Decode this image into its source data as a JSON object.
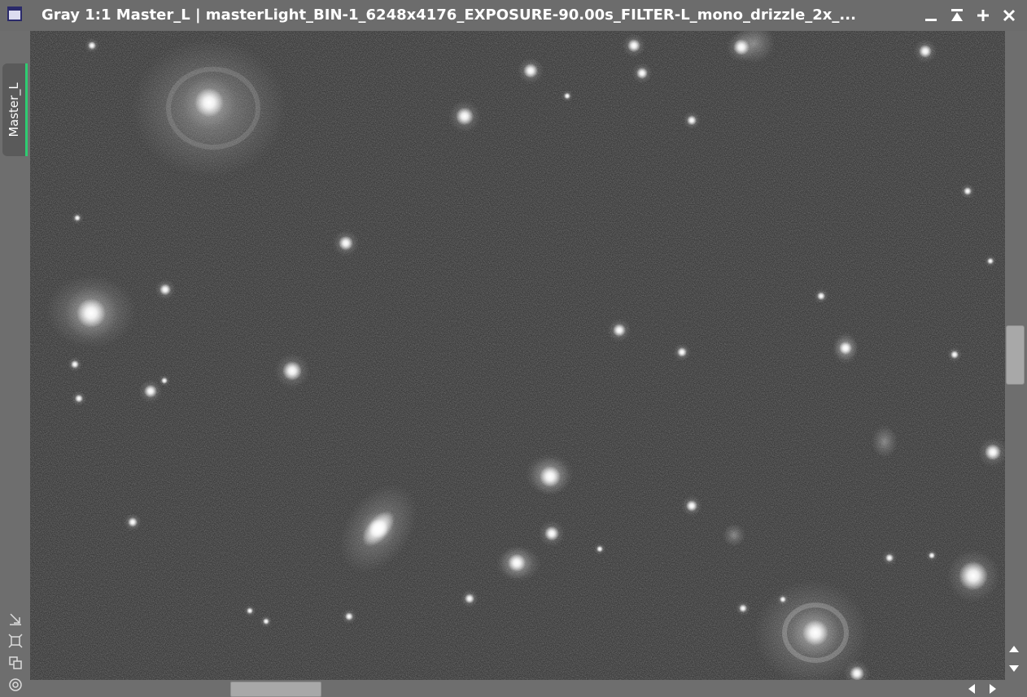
{
  "window": {
    "title": "Gray 1:1 Master_L | masterLight_BIN-1_6248x4176_EXPOSURE-90.00s_FILTER-L_mono_drizzle_2x_...",
    "icon": "window-icon",
    "buttons": [
      "minimize-icon",
      "shade-icon",
      "maximize-icon",
      "close-icon"
    ]
  },
  "sidebar": {
    "view_tab_label": "Master_L",
    "accent_color": "#2ecc71",
    "tools": [
      "resize-icon",
      "fit-view-icon",
      "clone-icon",
      "target-icon"
    ]
  },
  "image": {
    "description_free": true,
    "mode": "grayscale"
  },
  "scrollbars": {
    "vertical": {
      "arrows": [
        "scroll-up-icon",
        "scroll-down-icon"
      ]
    },
    "horizontal": {
      "arrows": [
        "scroll-left-icon",
        "scroll-right-icon"
      ]
    }
  }
}
